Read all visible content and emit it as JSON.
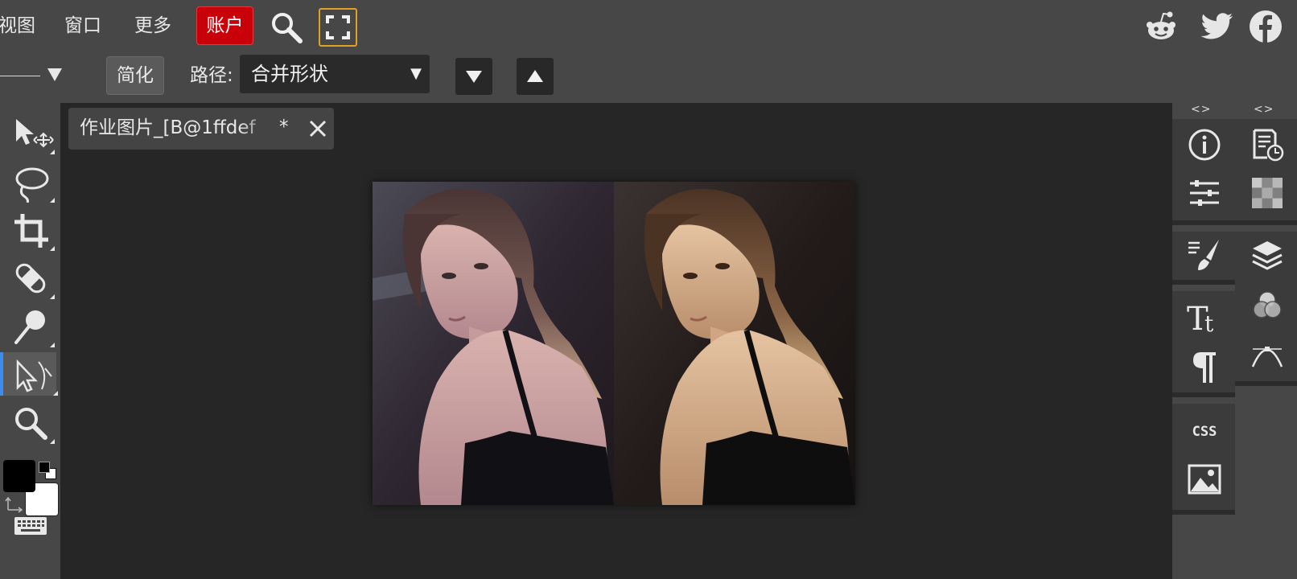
{
  "menubar": {
    "items": [
      {
        "label": "视图"
      },
      {
        "label": "窗口"
      },
      {
        "label": "更多"
      }
    ],
    "account_label": "账户",
    "search_icon": "search-icon",
    "fullscreen_icon": "fullscreen-icon",
    "social": [
      "reddit-icon",
      "twitter-icon",
      "facebook-icon"
    ]
  },
  "options": {
    "simplify_label": "简化",
    "path_label": "路径:",
    "path_value": "合并形状",
    "arrow_down_icon": "triangle-down-icon",
    "arrow_up_icon": "triangle-up-icon"
  },
  "tools": {
    "items": [
      {
        "name": "move-select-tool",
        "icon": "arrow-move-icon"
      },
      {
        "name": "lasso-tool",
        "icon": "lasso-icon"
      },
      {
        "name": "crop-tool",
        "icon": "crop-icon"
      },
      {
        "name": "healing-tool",
        "icon": "bandage-icon"
      },
      {
        "name": "brush-tool",
        "icon": "brush-icon"
      },
      {
        "name": "path-select-tool",
        "icon": "path-select-icon"
      },
      {
        "name": "zoom-tool",
        "icon": "zoom-icon"
      }
    ],
    "foreground_color": "#000000",
    "background_color": "#ffffff",
    "keyboard_icon": "keyboard-icon"
  },
  "document": {
    "tab_title": "作业图片_[B@1ffdef",
    "tab_modified": "*"
  },
  "right_panel": {
    "collapse_left": "<>",
    "collapse_right": "<>",
    "icons": [
      "info-icon",
      "history-icon",
      "adjustments-icon",
      "swatches-icon",
      "brush-settings-icon",
      "layers-icon",
      "channels-icon",
      "text-icon",
      "paragraph-icon",
      "paths-icon",
      "css-icon",
      "image-icon"
    ],
    "css_label": "CSS"
  },
  "colors": {
    "accent_active_tool": "#3b8cf0",
    "account_red": "#c9000a",
    "fullscreen_border": "#e0a020"
  }
}
